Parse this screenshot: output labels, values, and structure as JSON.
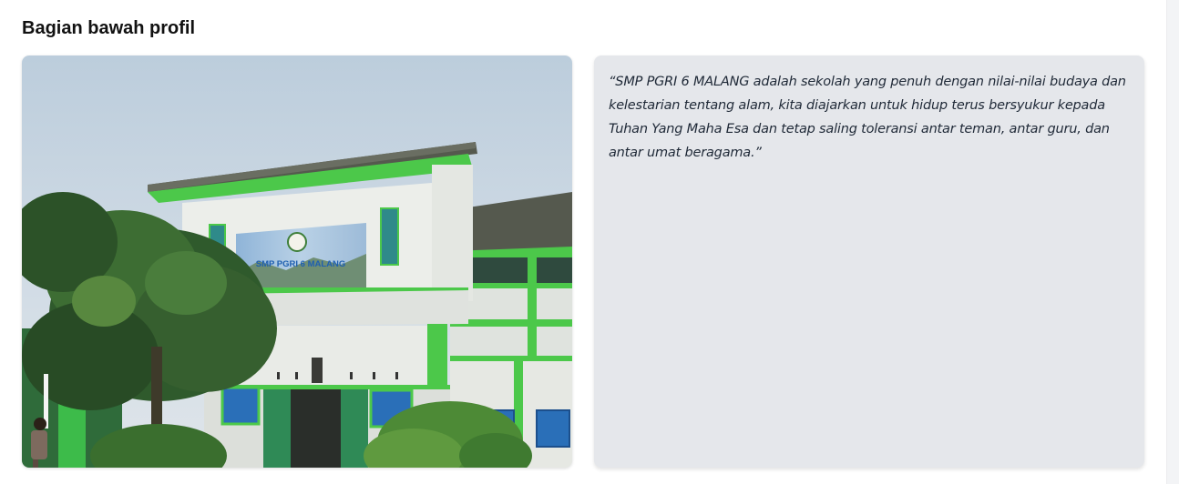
{
  "section": {
    "title": "Bagian bawah profil"
  },
  "photo": {
    "sign_text": "SMP PGRI 6 MALANG",
    "alt": "Gedung SMP PGRI 6 Malang"
  },
  "quote": {
    "text": "“SMP PGRI 6 MALANG adalah sekolah yang penuh dengan nilai-nilai budaya dan kelestarian tentang alam, kita diajarkan untuk hidup terus bersyukur kepada Tuhan Yang Maha Esa dan tetap saling toleransi antar teman, antar guru, dan antar umat beragama.”"
  },
  "colors": {
    "page_bg": "#ffffff",
    "quote_bg": "#e5e7eb",
    "building_green": "#4cc84a",
    "wall_white": "#e9ece8",
    "roof": "#5c5f53",
    "sky": "#cfdbe6"
  }
}
